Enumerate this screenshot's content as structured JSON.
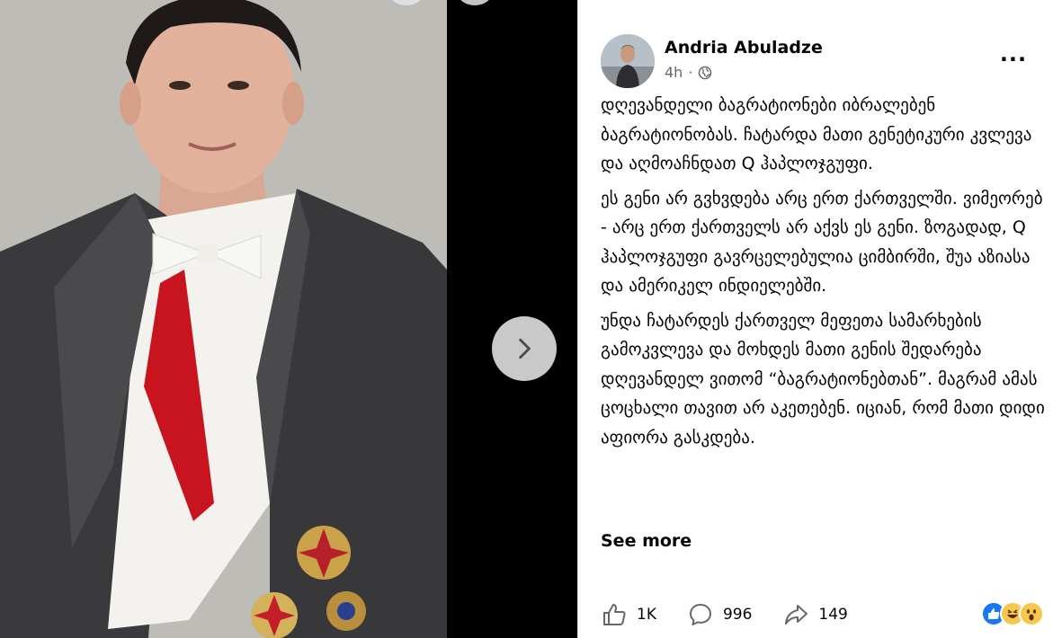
{
  "post": {
    "author": "Andria Abuladze",
    "time": "4h",
    "visibility_icon": "globe-icon",
    "paragraphs": [
      "დღევანდელი ბაგრატიონები იბრალებენ ბაგრატიონობას. ჩატარდა მათი გენეტიკური კვლევა და აღმოაჩნდათ Q ჰაპლოჯგუფი.",
      "ეს გენი არ გვხვდება არც ერთ ქართველში. ვიმეორებ - არც ერთ ქართველს არ აქვს ეს გენი. ზოგადად, Q ჰაპლოჯგუფი გავრცელებულია ციმბირში, შუა აზიასა და ამერიკელ ინდიელებში.",
      "უნდა ჩატარდეს ქართველ მეფეთა სამარხების გამოკვლევა და მოხდეს მათი გენის შედარება დღევანდელ ვითომ “ბაგრატიონებთან”. მაგრამ ამას ცოცხალი თავით არ აკეთებენ. იციან, რომ მათი დიდი აფიორა გასკდება."
    ],
    "see_more": "See more"
  },
  "actions": {
    "like_count": "1K",
    "comment_count": "996",
    "share_count": "149"
  },
  "reactions": [
    "like-reaction-icon",
    "haha-reaction-icon",
    "wow-reaction-icon"
  ],
  "colors": {
    "accent_blue": "#1877f2",
    "text_primary": "#050505",
    "text_secondary": "#65676b",
    "viewer_bg": "#000000"
  }
}
